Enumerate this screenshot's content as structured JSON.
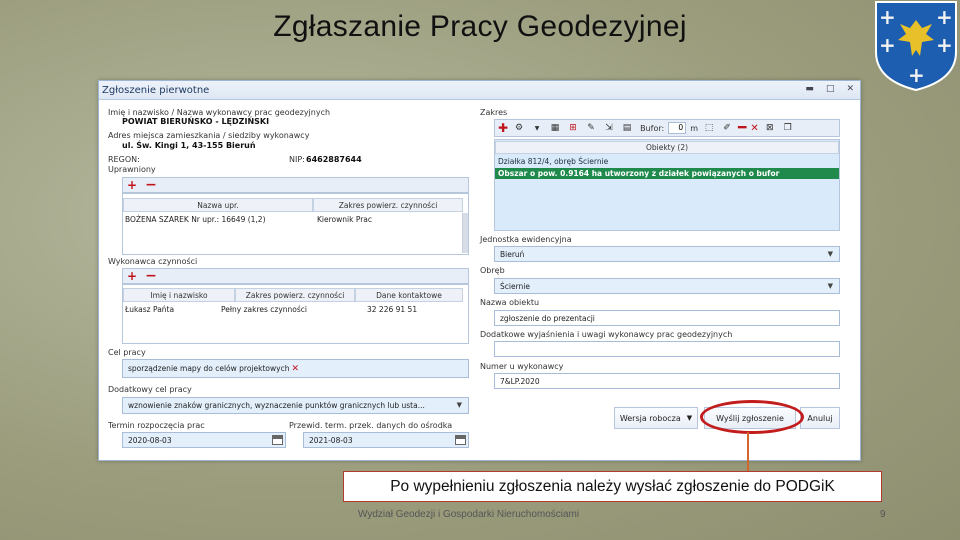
{
  "slide": {
    "title": "Zgłaszanie Pracy Geodezyjnej",
    "caption": "Po wypełnieniu zgłoszenia należy wysłać zgłoszenie do PODGiK",
    "footer": "Wydział Geodezji i Gospodarki Nieruchomościami",
    "page_number": "9"
  },
  "window": {
    "title": "Zgłoszenie pierwotne",
    "controls": [
      "▬",
      "□",
      "✕"
    ]
  },
  "left": {
    "contractor_label": "Imię i nazwisko / Nazwa wykonawcy prac geodezyjnych",
    "contractor_value": "POWIAT BIERUŃSKO - LĘDZIŃSKI",
    "address_label": "Adres miejsca zamieszkania / siedziby wykonawcy",
    "address_value": "ul. Św. Kingi 1, 43-155 Bieruń",
    "regon_label": "REGON:",
    "nip_label": "NIP:",
    "nip_value": "6462887644",
    "authorized_label": "Uprawniony",
    "auth_columns": [
      "Nazwa upr.",
      "Zakres powierz. czynności"
    ],
    "auth_rows": [
      [
        "BOŻENA SZAREK Nr upr.: 16649 (1,2)",
        "Kierownik Prac"
      ]
    ],
    "performer_label": "Wykonawca czynności",
    "perf_columns": [
      "Imię i nazwisko",
      "Zakres powierz. czynności",
      "Dane kontaktowe"
    ],
    "perf_rows": [
      [
        "Łukasz Pańta",
        "Pełny zakres czynności",
        "32 226 91 51"
      ]
    ],
    "purpose_label": "Cel pracy",
    "purpose_value": "sporządzenie mapy do celów projektowych",
    "additional_purpose_label": "Dodatkowy cel pracy",
    "additional_purpose_value": "wznowienie znaków granicznych, wyznaczenie punktów granicznych lub usta...",
    "start_label": "Termin rozpoczęcia prac",
    "start_value": "2020-08-03",
    "end_label": "Przewid. term. przek. danych do ośrodka",
    "end_value": "2021-08-03"
  },
  "right": {
    "scope_label": "Zakres",
    "buffer_label": "Bufor:",
    "buffer_value": "0",
    "buffer_unit": "m",
    "objects_header": "Obiekty (2)",
    "objects": [
      "Działka 812/4, obręb Ściernie",
      "Obszar o pow. 0.9164 ha utworzony z działek powiązanych o bufor"
    ],
    "unit_label": "Jednostka ewidencyjna",
    "unit_value": "Bieruń",
    "district_label": "Obręb",
    "district_value": "Ściernie",
    "object_name_label": "Nazwa obiektu",
    "object_name_value": "zgłoszenie do prezentacji",
    "explanations_label": "Dodatkowe wyjaśnienia i uwagi wykonawcy prac geodezyjnych",
    "explanations_value": "",
    "number_label": "Numer u wykonawcy",
    "number_value": "7&LP.2020"
  },
  "buttons": {
    "draft": "Wersja robocza",
    "send": "Wyślij zgłoszenie",
    "cancel": "Anuluj"
  },
  "colors": {
    "highlight_red": "#c21c1c",
    "selected_row": "#1f8a4c",
    "field_blue": "#e3effb"
  }
}
